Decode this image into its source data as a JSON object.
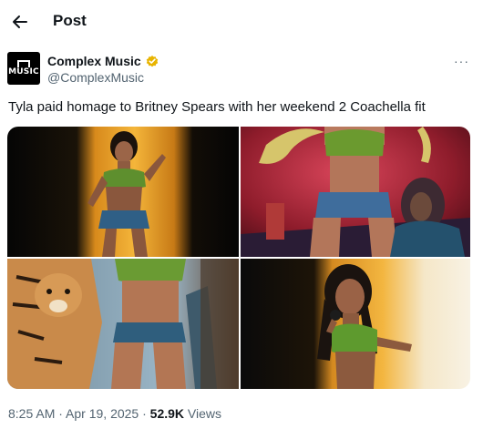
{
  "header": {
    "title": "Post",
    "back_icon": "arrow-left-icon"
  },
  "author": {
    "avatar_text": "MUSIC",
    "name": "Complex Music",
    "handle": "@ComplexMusic",
    "verified_icon": "verified-badge-icon",
    "verified_color": "#e8b400"
  },
  "menu": {
    "label": "···"
  },
  "post": {
    "text": "Tyla paid homage to Britney Spears with her weekend 2 Coachella fit"
  },
  "media": [
    {
      "subject": "performer-yellow-backdrop"
    },
    {
      "subject": "performer-with-snake"
    },
    {
      "subject": "performer-with-tiger"
    },
    {
      "subject": "performer-with-microphone"
    }
  ],
  "meta": {
    "time": "8:25 AM",
    "separator1": " · ",
    "date": "Apr 19, 2025",
    "separator2": " · ",
    "views_count": "52.9K",
    "views_label": " Views"
  }
}
